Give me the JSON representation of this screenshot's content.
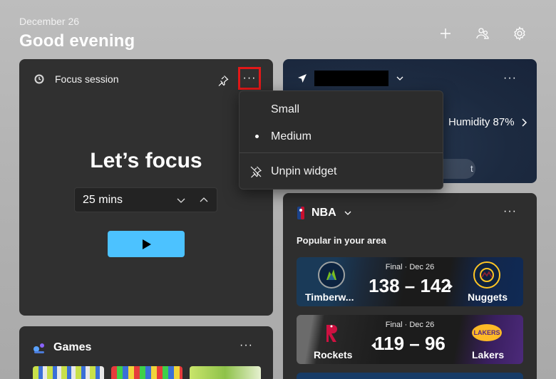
{
  "header": {
    "date": "December 26",
    "greeting": "Good evening"
  },
  "header_actions": {
    "add_icon": "plus-icon",
    "people_icon": "people-icon",
    "settings_icon": "gear-icon"
  },
  "focus_widget": {
    "title": "Focus session",
    "heading": "Let’s focus",
    "duration": "25 mins",
    "more_label": "···"
  },
  "games_widget": {
    "title": "Games",
    "more_label": "···"
  },
  "weather_widget": {
    "humidity": "Humidity 87%",
    "pill_text": "t",
    "more_label": "···"
  },
  "nba_widget": {
    "title": "NBA",
    "subtitle": "Popular in your area",
    "more_label": "···",
    "games": [
      {
        "status": "Final · Dec 26",
        "score": "138 – 142",
        "home": "Timberw...",
        "away": "Nuggets"
      },
      {
        "status": "Final · Dec 26",
        "score": "119 – 96",
        "home": "Rockets",
        "away": "Lakers",
        "away_logo_text": "LAKERS"
      }
    ]
  },
  "context_menu": {
    "items": [
      {
        "label": "Small"
      },
      {
        "label": "Medium"
      },
      {
        "label": "Unpin widget"
      }
    ]
  },
  "colors": {
    "accent": "#4cc2ff",
    "highlight": "#e21818"
  }
}
